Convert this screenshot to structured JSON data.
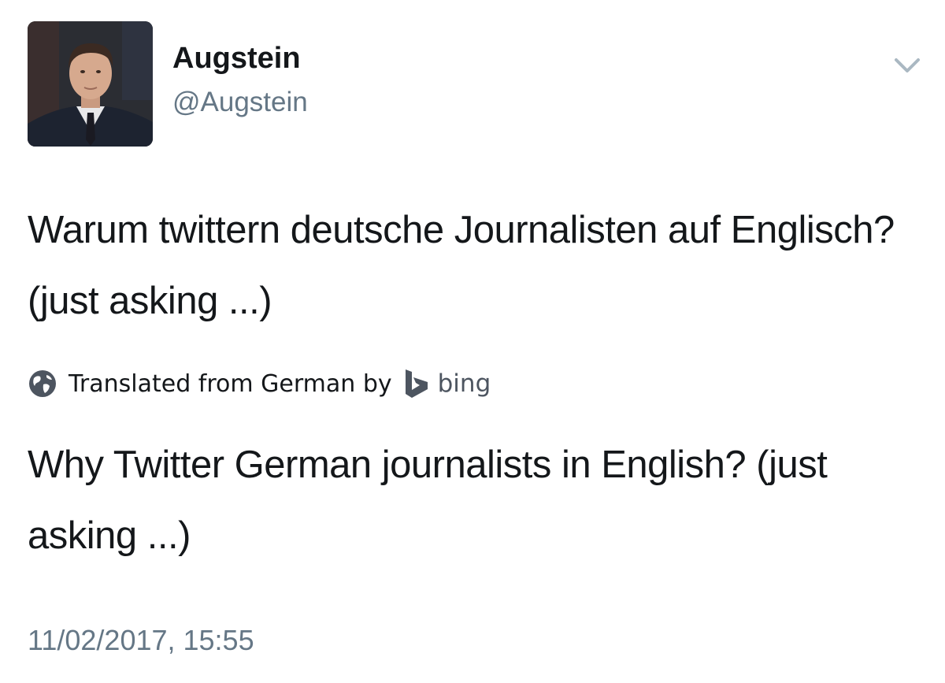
{
  "tweet": {
    "author": {
      "display_name": "Augstein",
      "handle": "@Augstein"
    },
    "original_text": "Warum twittern deutsche Journalisten auf Englisch? (just asking ...)",
    "translation": {
      "label": "Translated from German by",
      "provider": "bing",
      "text": "Why Twitter German journalists in English? (just asking ...)"
    },
    "timestamp": "11/02/2017, 15:55"
  },
  "icons": {
    "menu": "chevron-down-icon",
    "translation": "globe-icon",
    "provider_logo": "bing-logo-icon"
  },
  "colors": {
    "text": "#14171a",
    "secondary_text": "#657786",
    "chevron": "#aab8c2",
    "globe": "#4d5560"
  }
}
